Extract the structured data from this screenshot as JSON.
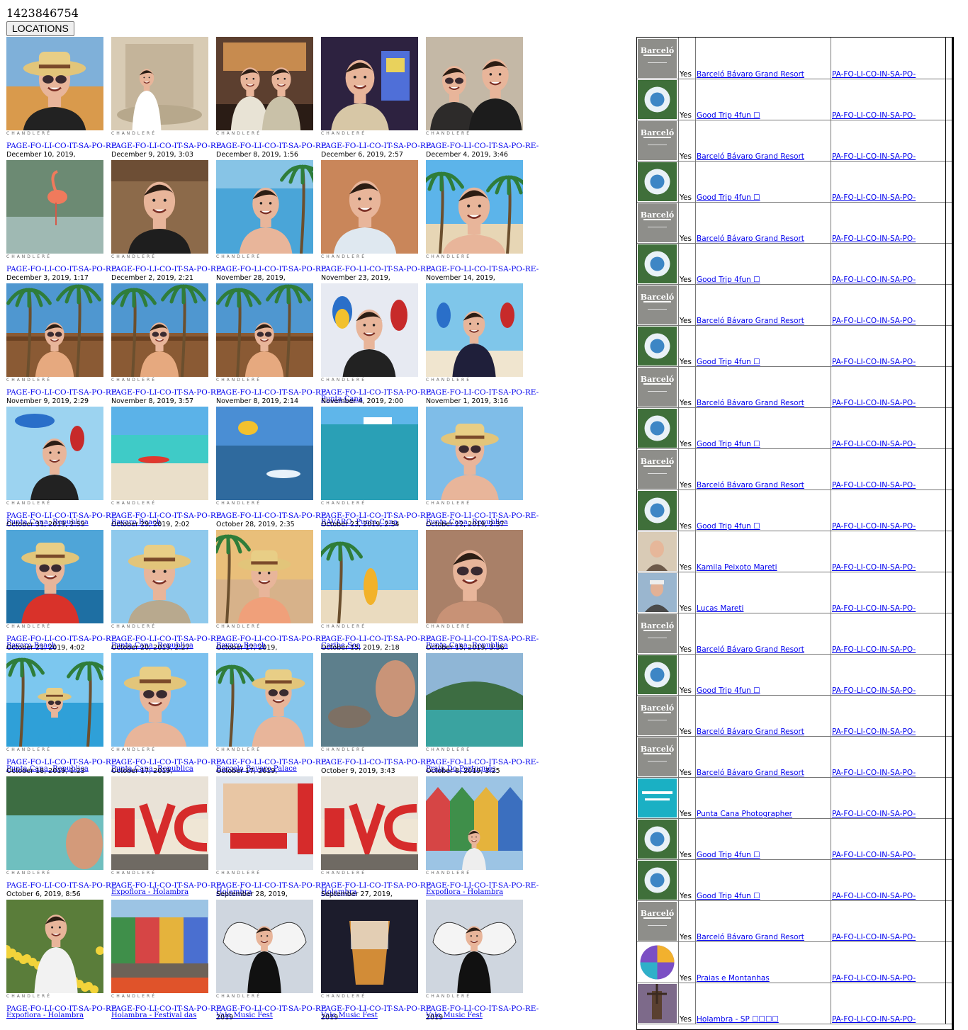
{
  "page_id": "1423846754",
  "locations_button": "LOCATIONS",
  "watermark": "CHANDLERÉ",
  "posts": [
    {
      "link": "PAGE-FO-LI-CO-IT-SA-PO-RE-",
      "location": "",
      "date": "December 10, 2019,",
      "scene": "selfie-hat"
    },
    {
      "link": "PAGE-FO-LI-CO-IT-SA-PO-RE-",
      "location": "",
      "date": "December 9, 2019, 3:03",
      "scene": "fountain"
    },
    {
      "link": "PAGE-FO-LI-CO-IT-SA-PO-RE-",
      "location": "",
      "date": "December 8, 2019, 1:56",
      "scene": "bar"
    },
    {
      "link": "PAGE-FO-LI-CO-IT-SA-PO-RE-",
      "location": "",
      "date": "December 6, 2019, 2:57",
      "scene": "casino"
    },
    {
      "link": "PAGE-FO-LI-CO-IT-SA-PO-RE-",
      "location": "",
      "date": "December 4, 2019, 3:46",
      "scene": "couple"
    },
    {
      "link": "PAGE-FO-LI-CO-IT-SA-PO-RE-",
      "location": "",
      "date": "December 3, 2019, 1:17",
      "scene": "flamingo"
    },
    {
      "link": "PAGE-FO-LI-CO-IT-SA-PO-RE-",
      "location": "",
      "date": "December 2, 2019, 2:21",
      "scene": "lobby"
    },
    {
      "link": "PAGE-FO-LI-CO-IT-SA-PO-RE-",
      "location": "",
      "date": "November 28, 2019,",
      "scene": "pool"
    },
    {
      "link": "PAGE-FO-LI-CO-IT-SA-PO-RE-",
      "location": "",
      "date": "November 23, 2019,",
      "scene": "tank"
    },
    {
      "link": "PAGE-FO-LI-CO-IT-SA-PO-RE-",
      "location": "",
      "date": "November 14, 2019,",
      "scene": "beach-selfie"
    },
    {
      "link": "PAGE-FO-LI-CO-IT-SA-PO-RE-",
      "location": "",
      "date": "November 9, 2019, 2:29",
      "scene": "palm-ship"
    },
    {
      "link": "PAGE-FO-LI-CO-IT-SA-PO-RE-",
      "location": "",
      "date": "November 8, 2019, 3:57",
      "scene": "palm-ship"
    },
    {
      "link": "PAGE-FO-LI-CO-IT-SA-PO-RE-",
      "location": "",
      "date": "November 8, 2019, 2:14",
      "scene": "palm-ship"
    },
    {
      "link": "PAGE-FO-LI-CO-IT-SA-PO-RE-",
      "location": "Punta Cana",
      "date": "November 4, 2019, 2:00",
      "scene": "parrots"
    },
    {
      "link": "PAGE-FO-LI-CO-IT-SA-PO-RE-",
      "location": "",
      "date": "November 1, 2019, 3:16",
      "scene": "parrots-beach"
    },
    {
      "link": "PAGE-FO-LI-CO-IT-SA-PO-RE-",
      "location": "Punta Cana, Republica",
      "date": "October 31, 2019, 2:59",
      "scene": "parrots-sky"
    },
    {
      "link": "PAGE-FO-LI-CO-IT-SA-PO-RE-",
      "location": "Bavaro Beach",
      "date": "October 29, 2019, 2:02",
      "scene": "kayak"
    },
    {
      "link": "PAGE-FO-LI-CO-IT-SA-PO-RE-",
      "location": "",
      "date": "October 28, 2019, 2:35",
      "scene": "parasail"
    },
    {
      "link": "PAGE-FO-LI-CO-IT-SA-PO-RE-",
      "location": "BÁVARO, Punta Cana",
      "date": "October 23, 2019, 2:54",
      "scene": "snorkel"
    },
    {
      "link": "PAGE-FO-LI-CO-IT-SA-PO-RE-",
      "location": "Punta Cana, Republica",
      "date": "October 22, 2019, 2:37",
      "scene": "hat-sky"
    },
    {
      "link": "PAGE-FO-LI-CO-IT-SA-PO-RE-",
      "location": "Bavaro Beach",
      "date": "October 21, 2019, 4:02",
      "scene": "lifejacket"
    },
    {
      "link": "PAGE-FO-LI-CO-IT-SA-PO-RE-",
      "location": "Punta Cana, Republica",
      "date": "October 20, 2019, 2:27",
      "scene": "hat-shirt"
    },
    {
      "link": "PAGE-FO-LI-CO-IT-SA-PO-RE-",
      "location": "Bavaro Beach",
      "date": "October 17, 2019,",
      "scene": "sunset"
    },
    {
      "link": "PAGE-FO-LI-CO-IT-SA-PO-RE-",
      "location": "Caribe Sea",
      "date": "October 15, 2019, 2:18",
      "scene": "surfboard"
    },
    {
      "link": "PAGE-FO-LI-CO-IT-SA-PO-RE-",
      "location": "Punta Cana, Republica",
      "date": "October 15, 2019, 3:36",
      "scene": "lying"
    },
    {
      "link": "PAGE-FO-LI-CO-IT-SA-PO-RE-",
      "location": "Punta Cana, Republica",
      "date": "October 18, 2019, 1:23",
      "scene": "pool-hat"
    },
    {
      "link": "PAGE-FO-LI-CO-IT-SA-PO-RE-",
      "location": "Punta Cana, Republica",
      "date": "October 17, 2019,",
      "scene": "hat-selfie"
    },
    {
      "link": "PAGE-FO-LI-CO-IT-SA-PO-RE-",
      "location": "Barcelo Bavaro Palace",
      "date": "October 17, 2019,",
      "scene": "palm-hat"
    },
    {
      "link": "PAGE-FO-LI-CO-IT-SA-PO-RE-",
      "location": "",
      "date": "October 9, 2019, 3:43",
      "scene": "rocks"
    },
    {
      "link": "PAGE-FO-LI-CO-IT-SA-PO-RE-",
      "location": "Praia Do Português",
      "date": "October 8, 2019, 3:25",
      "scene": "cove"
    },
    {
      "link": "PAGE-FO-LI-CO-IT-SA-PO-RE-",
      "location": "",
      "date": "October 6, 2019, 8:56",
      "scene": "shore"
    },
    {
      "link": "PAGE-FO-LI-CO-IT-SA-PO-RE-",
      "location": "Expoflora - Holambra",
      "date": "",
      "scene": "euvc"
    },
    {
      "link": "PAGE-FO-LI-CO-IT-SA-PO-RE-",
      "location": "Holambra",
      "date": "September 28, 2019,",
      "scene": "expoflora"
    },
    {
      "link": "PAGE-FO-LI-CO-IT-SA-PO-RE-",
      "location": "Holambra",
      "date": "September 27, 2019,",
      "scene": "euvc"
    },
    {
      "link": "PAGE-FO-LI-CO-IT-SA-PO-RE-",
      "location": "Expoflora - Holambra",
      "date": "",
      "scene": "houses"
    },
    {
      "link": "PAGE-FO-LI-CO-IT-SA-PO-RE-",
      "location": "Expoflora - Holambra",
      "date": "",
      "scene": "flowers"
    },
    {
      "link": "PAGE-FO-LI-CO-IT-SA-PO-RE-",
      "location": "Holambra - Festival das",
      "date": "",
      "scene": "houses-crowd"
    },
    {
      "link": "PAGE-FO-LI-CO-IT-SA-PO-RE-",
      "location": "Vale Music Fest",
      "date": "2019",
      "scene": "wings"
    },
    {
      "link": "PAGE-FO-LI-CO-IT-SA-PO-RE-",
      "location": "Vale Music Fest",
      "date": "2019",
      "scene": "cup"
    },
    {
      "link": "PAGE-FO-LI-CO-IT-SA-PO-RE-",
      "location": "Vale Music Fest",
      "date": "2019",
      "scene": "wings"
    }
  ],
  "locations": [
    {
      "avatar": "barcelo",
      "flag": "Yes",
      "name": "Barceló Bávaro Grand Resort",
      "link": "PA-FO-LI-CO-IN-SA-PO-"
    },
    {
      "avatar": "goodtrip",
      "flag": "Yes",
      "name": "Good Trip 4fun ☐",
      "link": "PA-FO-LI-CO-IN-SA-PO-"
    },
    {
      "avatar": "barcelo",
      "flag": "Yes",
      "name": "Barceló Bávaro Grand Resort",
      "link": "PA-FO-LI-CO-IN-SA-PO-"
    },
    {
      "avatar": "goodtrip",
      "flag": "Yes",
      "name": "Good Trip 4fun ☐",
      "link": "PA-FO-LI-CO-IN-SA-PO-"
    },
    {
      "avatar": "barcelo",
      "flag": "Yes",
      "name": "Barceló Bávaro Grand Resort",
      "link": "PA-FO-LI-CO-IN-SA-PO-"
    },
    {
      "avatar": "goodtrip",
      "flag": "Yes",
      "name": "Good Trip 4fun ☐",
      "link": "PA-FO-LI-CO-IN-SA-PO-"
    },
    {
      "avatar": "barcelo",
      "flag": "Yes",
      "name": "Barceló Bávaro Grand Resort",
      "link": "PA-FO-LI-CO-IN-SA-PO-"
    },
    {
      "avatar": "goodtrip",
      "flag": "Yes",
      "name": "Good Trip 4fun ☐",
      "link": "PA-FO-LI-CO-IN-SA-PO-"
    },
    {
      "avatar": "barcelo",
      "flag": "Yes",
      "name": "Barceló Bávaro Grand Resort",
      "link": "PA-FO-LI-CO-IN-SA-PO-"
    },
    {
      "avatar": "goodtrip",
      "flag": "Yes",
      "name": "Good Trip 4fun ☐",
      "link": "PA-FO-LI-CO-IN-SA-PO-"
    },
    {
      "avatar": "barcelo",
      "flag": "Yes",
      "name": "Barceló Bávaro Grand Resort",
      "link": "PA-FO-LI-CO-IN-SA-PO-"
    },
    {
      "avatar": "goodtrip",
      "flag": "Yes",
      "name": "Good Trip 4fun ☐",
      "link": "PA-FO-LI-CO-IN-SA-PO-"
    },
    {
      "avatar": "woman",
      "flag": "Yes",
      "name": "Kamila Peixoto Mareti",
      "link": "PA-FO-LI-CO-IN-SA-PO-"
    },
    {
      "avatar": "man",
      "flag": "Yes",
      "name": "Lucas Mareti",
      "link": "PA-FO-LI-CO-IN-SA-PO-"
    },
    {
      "avatar": "barcelo",
      "flag": "Yes",
      "name": "Barceló Bávaro Grand Resort",
      "link": "PA-FO-LI-CO-IN-SA-PO-"
    },
    {
      "avatar": "goodtrip",
      "flag": "Yes",
      "name": "Good Trip 4fun ☐",
      "link": "PA-FO-LI-CO-IN-SA-PO-"
    },
    {
      "avatar": "barcelo",
      "flag": "Yes",
      "name": "Barceló Bávaro Grand Resort",
      "link": "PA-FO-LI-CO-IN-SA-PO-"
    },
    {
      "avatar": "barcelo",
      "flag": "Yes",
      "name": "Barceló Bávaro Grand Resort",
      "link": "PA-FO-LI-CO-IN-SA-PO-"
    },
    {
      "avatar": "puntacana",
      "flag": "Yes",
      "name": "Punta Cana Photographer",
      "link": "PA-FO-LI-CO-IN-SA-PO-"
    },
    {
      "avatar": "goodtrip",
      "flag": "Yes",
      "name": "Good Trip 4fun ☐",
      "link": "PA-FO-LI-CO-IN-SA-PO-"
    },
    {
      "avatar": "goodtrip",
      "flag": "Yes",
      "name": "Good Trip 4fun ☐",
      "link": "PA-FO-LI-CO-IN-SA-PO-"
    },
    {
      "avatar": "barcelo",
      "flag": "Yes",
      "name": "Barceló Bávaro Grand Resort",
      "link": "PA-FO-LI-CO-IN-SA-PO-"
    },
    {
      "avatar": "praias",
      "flag": "Yes",
      "name": "Praias e Montanhas",
      "link": "PA-FO-LI-CO-IN-SA-PO-"
    },
    {
      "avatar": "holambra",
      "flag": "Yes",
      "name": "Holambra - SP ☐☐☐☐",
      "link": "PA-FO-LI-CO-IN-SA-PO-"
    }
  ]
}
